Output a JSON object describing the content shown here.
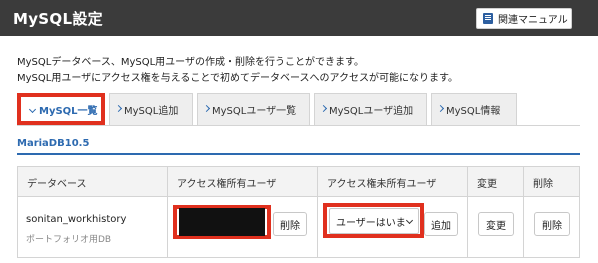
{
  "header": {
    "title": "MySQL設定",
    "manual_button": "関連マニュアル"
  },
  "description": {
    "line1": "MySQLデータベース、MySQL用ユーザの作成・削除を行うことができます。",
    "line2": "MySQL用ユーザにアクセス権を与えることで初めてデータベースへのアクセスが可能になります。"
  },
  "tabs": [
    {
      "label": "MySQL一覧",
      "active": true
    },
    {
      "label": "MySQL追加",
      "active": false
    },
    {
      "label": "MySQLユーザ一覧",
      "active": false
    },
    {
      "label": "MySQLユーザ追加",
      "active": false
    },
    {
      "label": "MySQL情報",
      "active": false
    }
  ],
  "section": {
    "title": "MariaDB10.5"
  },
  "table": {
    "headers": [
      "データベース",
      "アクセス権所有ユーザ",
      "アクセス権未所有ユーザ",
      "変更",
      "削除"
    ],
    "rows": [
      {
        "database": "sonitan_workhistory",
        "comment": "ポートフォリオ用DB",
        "owner_delete": "削除",
        "select_value": "ユーザーはいま",
        "add": "追加",
        "change": "変更",
        "delete": "削除"
      }
    ]
  },
  "colors": {
    "header_bg": "#3b3b3b",
    "accent": "#2d6ab0",
    "highlight": "#e0301e"
  }
}
